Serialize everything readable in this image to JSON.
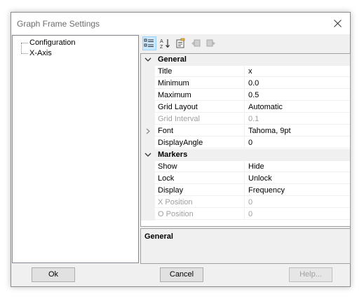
{
  "window": {
    "title": "Graph Frame Settings"
  },
  "tree": {
    "items": [
      {
        "label": "Configuration"
      },
      {
        "label": "X-Axis"
      }
    ]
  },
  "toolbar": {
    "buttons": [
      {
        "icon": "categorized-icon",
        "active": true
      },
      {
        "icon": "sort-alphabetical-icon"
      },
      {
        "icon": "property-pages-icon"
      },
      {
        "icon": "event-left-icon",
        "enabled": false
      },
      {
        "icon": "event-right-icon",
        "enabled": false
      }
    ]
  },
  "properties": {
    "general": {
      "label": "General",
      "rows": [
        {
          "name": "Title",
          "value": "x"
        },
        {
          "name": "Minimum",
          "value": "0.0"
        },
        {
          "name": "Maximum",
          "value": "0.5"
        },
        {
          "name": "Grid Layout",
          "value": "Automatic"
        },
        {
          "name": "Grid Interval",
          "value": "0.1",
          "disabled": true
        },
        {
          "name": "Font",
          "value": "Tahoma, 9pt",
          "expandable": true
        },
        {
          "name": "DisplayAngle",
          "value": "0"
        }
      ]
    },
    "markers": {
      "label": "Markers",
      "rows": [
        {
          "name": "Show",
          "value": "Hide"
        },
        {
          "name": "Lock",
          "value": "Unlock"
        },
        {
          "name": "Display",
          "value": "Frequency"
        },
        {
          "name": "X Position",
          "value": "0",
          "disabled": true
        },
        {
          "name": "O Position",
          "value": "0",
          "disabled": true
        }
      ]
    }
  },
  "help": {
    "title": "General"
  },
  "buttons": {
    "ok": "Ok",
    "cancel": "Cancel",
    "help": "Help..."
  },
  "colors": {
    "selection": "#cce8ff",
    "disabled_text": "#a0a0a0",
    "panel": "#f0f0f0"
  }
}
